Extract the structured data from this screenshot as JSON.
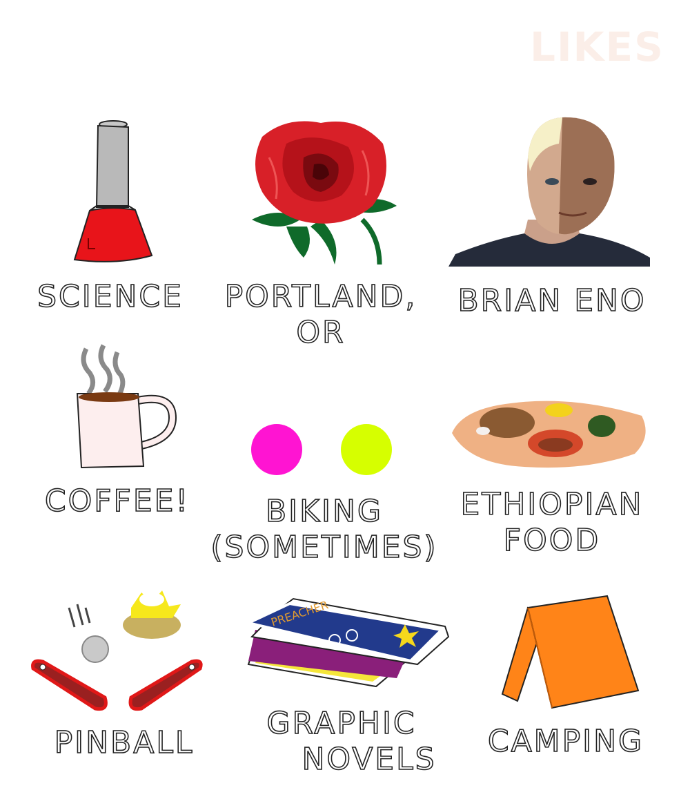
{
  "title": "LIKES",
  "items": [
    {
      "id": "science",
      "lines": [
        "SCIENCE"
      ],
      "icon": "erlenmeyer-flask-icon"
    },
    {
      "id": "portland",
      "lines": [
        "PORTLAND,",
        "OR"
      ],
      "icon": "rose-icon"
    },
    {
      "id": "brian-eno",
      "lines": [
        "BRIAN ENO"
      ],
      "icon": "portrait-image"
    },
    {
      "id": "coffee",
      "lines": [
        "COFFEE!"
      ],
      "icon": "coffee-mug-icon"
    },
    {
      "id": "biking",
      "lines": [
        "BIKING",
        "(SOMETIMES)"
      ],
      "icon": "wheels-icon"
    },
    {
      "id": "ethiopian-food",
      "lines": [
        "ETHIOPIAN",
        "FOOD"
      ],
      "icon": "injera-platter-icon"
    },
    {
      "id": "pinball",
      "lines": [
        "PINBALL"
      ],
      "icon": "pinball-flippers-icon"
    },
    {
      "id": "graphic-novels",
      "lines": [
        "GRAPHIC",
        "NOVELS"
      ],
      "icon": "comic-books-icon"
    },
    {
      "id": "camping",
      "lines": [
        "CAMPING"
      ],
      "icon": "tent-icon"
    }
  ],
  "comic_cover_text": "PREACHER",
  "colors": {
    "flask_liquid": "#e8141a",
    "rose_red": "#d82028",
    "biking_magenta": "#ff14d2",
    "biking_lime": "#d6ff00",
    "tent_orange": "#ff8418",
    "comic_blue": "#223a8c",
    "injera": "#efb184"
  }
}
